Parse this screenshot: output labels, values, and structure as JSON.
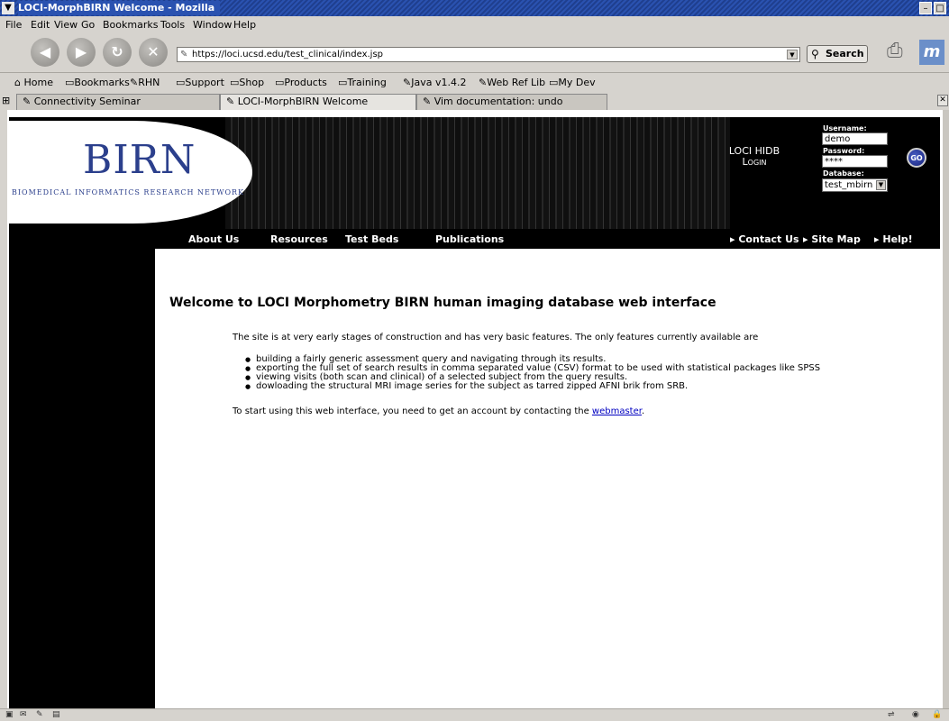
{
  "window": {
    "title": "LOCI-MorphBIRN Welcome - Mozilla"
  },
  "menu": [
    "File",
    "Edit",
    "View",
    "Go",
    "Bookmarks",
    "Tools",
    "Window",
    "Help"
  ],
  "nav": {
    "url": "https://loci.ucsd.edu/test_clinical/index.jsp",
    "search_label": "Search"
  },
  "bookmarks": [
    "Home",
    "Bookmarks",
    "RHN",
    "Support",
    "Shop",
    "Products",
    "Training",
    "Java v1.4.2",
    "Web Ref Lib",
    "My Dev"
  ],
  "tabs": [
    "Connectivity Seminar",
    "LOCI-MorphBIRN Welcome",
    "Vim documentation: undo"
  ],
  "banner": {
    "logo": "BIRN",
    "logo_sub": "BIOMEDICAL INFORMATICS RESEARCH NETWORK",
    "login_line1": "LOCI HIDB",
    "login_line2": "Login",
    "username_label": "Username:",
    "username_value": "demo",
    "password_label": "Password:",
    "password_value": "****",
    "database_label": "Database:",
    "database_value": "test_mbirn",
    "go_label": "GO"
  },
  "site_nav": {
    "left": [
      "About Us",
      "Resources",
      "Test Beds",
      "Publications"
    ],
    "right": [
      "Contact Us",
      "Site Map",
      "Help!"
    ]
  },
  "content": {
    "heading": "Welcome to LOCI Morphometry BIRN human imaging database web interface",
    "intro": "The site is at very early stages of construction and has very basic features. The only features currently available are",
    "features": [
      "building a fairly generic assessment query and navigating through its results.",
      "exporting the full set of search results in comma separated value (CSV) format to be used with statistical packages like SPSS",
      "viewing visits (both scan and clinical) of a selected subject from the query results.",
      "dowloading the structural MRI image series for the subject as tarred zipped AFNI brik from SRB."
    ],
    "outro_prefix": "To start using this web interface, you need to get an account by contacting the",
    "outro_link": "webmaster",
    "outro_suffix": "."
  }
}
